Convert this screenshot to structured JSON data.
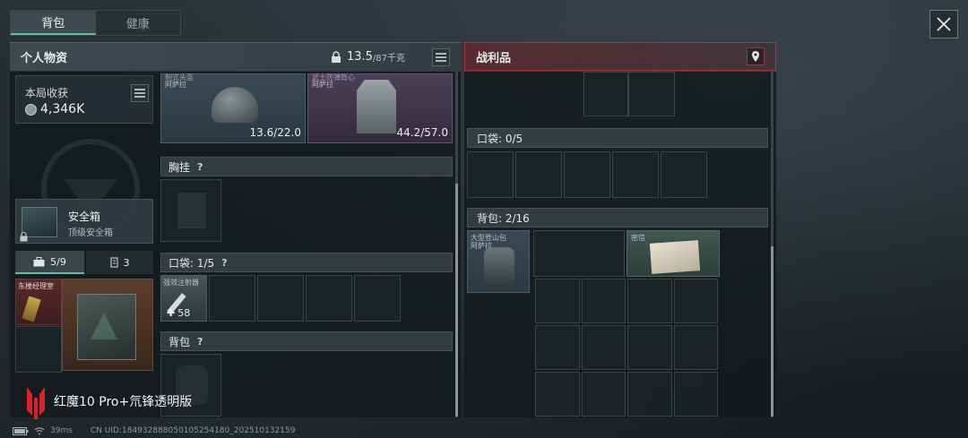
{
  "tabs": [
    "背包",
    "健康"
  ],
  "left_header": {
    "title": "个人物资",
    "weight": "13.5",
    "weight_suffix": "/87千克"
  },
  "right_header": {
    "title": "战利品"
  },
  "haul": {
    "label": "本局收获",
    "value": "4,346K"
  },
  "equip": {
    "helmet": {
      "label_top": "制式头盔",
      "label_sub": "阿萨拉",
      "durability": "13.6/22.0"
    },
    "armor": {
      "label_top": "武士防弹背心",
      "label_sub": "阿萨拉",
      "durability": "44.2/57.0"
    }
  },
  "sections": {
    "chest_rig": "胸挂",
    "pocket": "口袋: 1/5",
    "backpack": "背包",
    "q": "?"
  },
  "pocket_item": {
    "label": "强效注射器",
    "count": "58"
  },
  "safebox": {
    "title": "安全箱",
    "sub": "顶级安全箱"
  },
  "storage_tabs": {
    "a": "5/9",
    "b": "3"
  },
  "room": {
    "label": "东楼经理室"
  },
  "loot": {
    "pocket": "口袋: 0/5",
    "backpack": "背包: 2/16",
    "item1": "大型登山包",
    "item1_sub": "阿萨拉",
    "item2": "密信"
  },
  "watermark": "红魔10 Pro+氘锋透明版",
  "status": {
    "ping": "39ms",
    "uid": "CN UID:18493288805010525418​0_202510132159"
  },
  "colors": {
    "accent": "#5bc0a6",
    "loot_border": "#a2373b"
  }
}
